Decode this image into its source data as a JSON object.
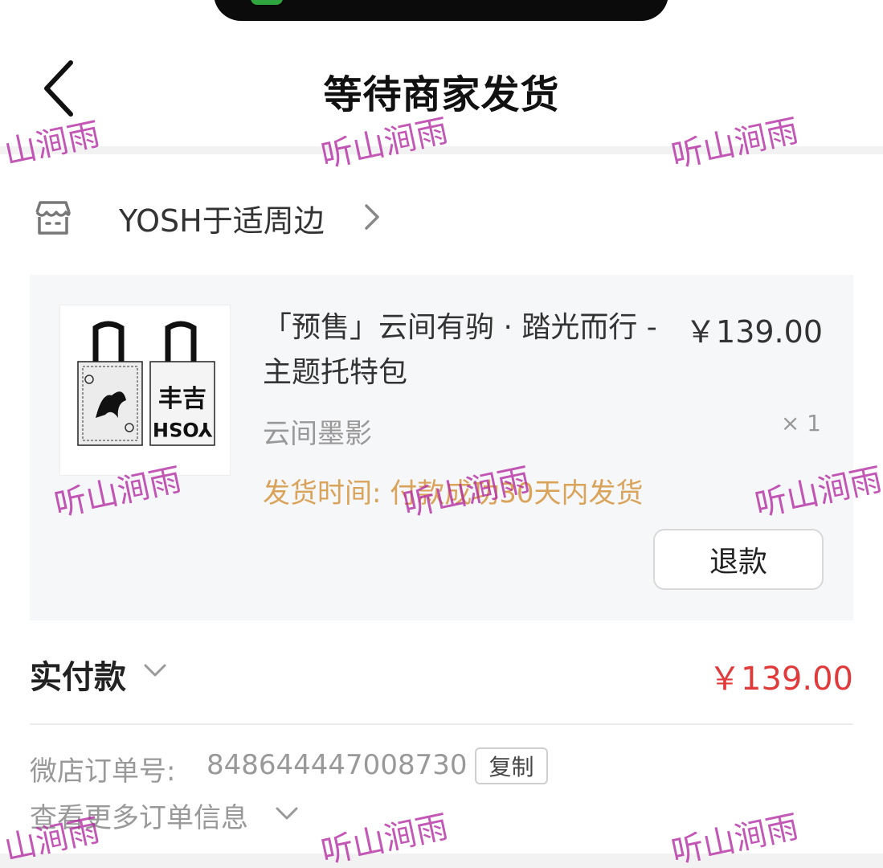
{
  "header": {
    "title": "等待商家发货"
  },
  "shop": {
    "name": "YOSH于适周边"
  },
  "product": {
    "title": "「预售」云间有驹 · 踏光而行 - 主题托特包",
    "price": "￥139.00",
    "variant": "云间墨影",
    "quantity": "× 1",
    "ship_time": "发货时间: 付款成功30天内发货",
    "refund_label": "退款",
    "image_text": {
      "left_bag_logo": "",
      "right_bag_logo": "YOSH",
      "right_bag_glyph": "丰吉"
    }
  },
  "payment": {
    "label": "实付款",
    "amount": "￥139.00"
  },
  "order": {
    "label": "微店订单号:",
    "number": "848644447008730",
    "copy_label": "复制"
  },
  "more_info": {
    "label": "查看更多订单信息"
  },
  "watermark": {
    "text": "听山涧雨",
    "partial": "山涧雨",
    "color": "#b228a0"
  },
  "colors": {
    "price_red": "#e03a3a",
    "ship_time_orange": "#d9a35a",
    "muted_text": "#999999"
  }
}
